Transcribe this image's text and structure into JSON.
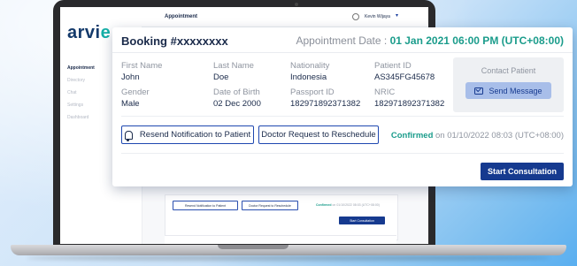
{
  "app": {
    "logo": "arvie",
    "header_title": "Appointment",
    "user_name": "Kevin Wijaya",
    "sidebar": [
      "Appointment",
      "Directory",
      "Chat",
      "Settings",
      "Dashboard"
    ]
  },
  "modal": {
    "booking_title": "Booking #xxxxxxxx",
    "appointment_date_label": "Appointment Date :",
    "appointment_date_value": "01 Jan 2021 06:00 PM (UTC+08:00)",
    "fields": [
      {
        "label": "First Name",
        "value": "John"
      },
      {
        "label": "Last Name",
        "value": "Doe"
      },
      {
        "label": "Nationality",
        "value": "Indonesia"
      },
      {
        "label": "Patient ID",
        "value": "AS345FG45678"
      },
      {
        "label": "Gender",
        "value": "Male"
      },
      {
        "label": "Date of Birth",
        "value": "02 Dec 2000"
      },
      {
        "label": "Passport ID",
        "value": "182971892371382"
      },
      {
        "label": "NRIC",
        "value": "182971892371382"
      }
    ],
    "contact": {
      "title": "Contact Patient",
      "send_label": "Send Message"
    },
    "actions": {
      "resend_label": "Resend Notification to Patient",
      "reschedule_label": "Doctor Request to Reschedule"
    },
    "status": {
      "state": "Confirmed",
      "detail": "on 01/10/2022 08:03 (UTC+08:00)"
    },
    "start_label": "Start Consultation"
  },
  "background_card": {
    "resend_label": "Resend Notification to Patient",
    "reschedule_label": "Doctor Request to Reschedule",
    "status_state": "Confirmed",
    "status_detail": "on 01/10/2022 08:03 (UTC+08:00)",
    "start_label": "Start Consultation"
  },
  "colors": {
    "brand_navy": "#163a8f",
    "accent_teal": "#1a9c8b",
    "send_button_bg": "#a8bee9"
  }
}
